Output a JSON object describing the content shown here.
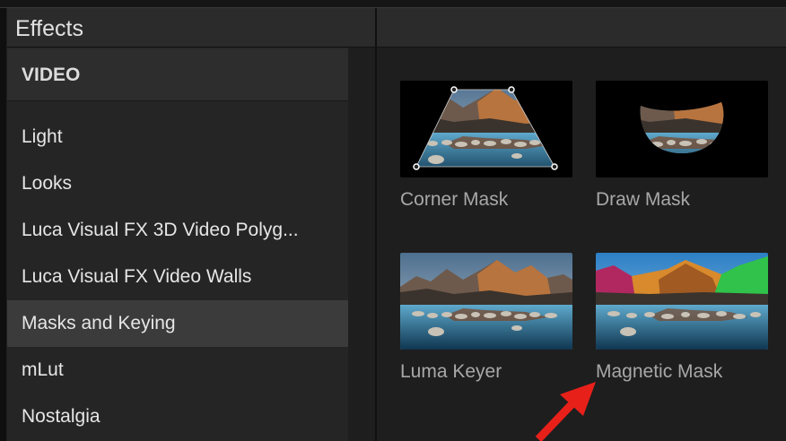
{
  "panel": {
    "title": "Effects"
  },
  "sidebar": {
    "section": "VIDEO",
    "items": [
      {
        "label": "Light"
      },
      {
        "label": "Looks"
      },
      {
        "label": "Luca Visual FX 3D Video Polyg..."
      },
      {
        "label": "Luca Visual FX Video Walls"
      },
      {
        "label": "Masks and Keying",
        "selected": true
      },
      {
        "label": "mLut"
      },
      {
        "label": "Nostalgia"
      }
    ]
  },
  "effects": [
    {
      "name": "Corner Mask"
    },
    {
      "name": "Draw Mask"
    },
    {
      "name": "Luma Keyer"
    },
    {
      "name": "Magnetic Mask"
    }
  ],
  "colors": {
    "selection": "#3b3b3b",
    "pointer_arrow": "#e8201a"
  }
}
